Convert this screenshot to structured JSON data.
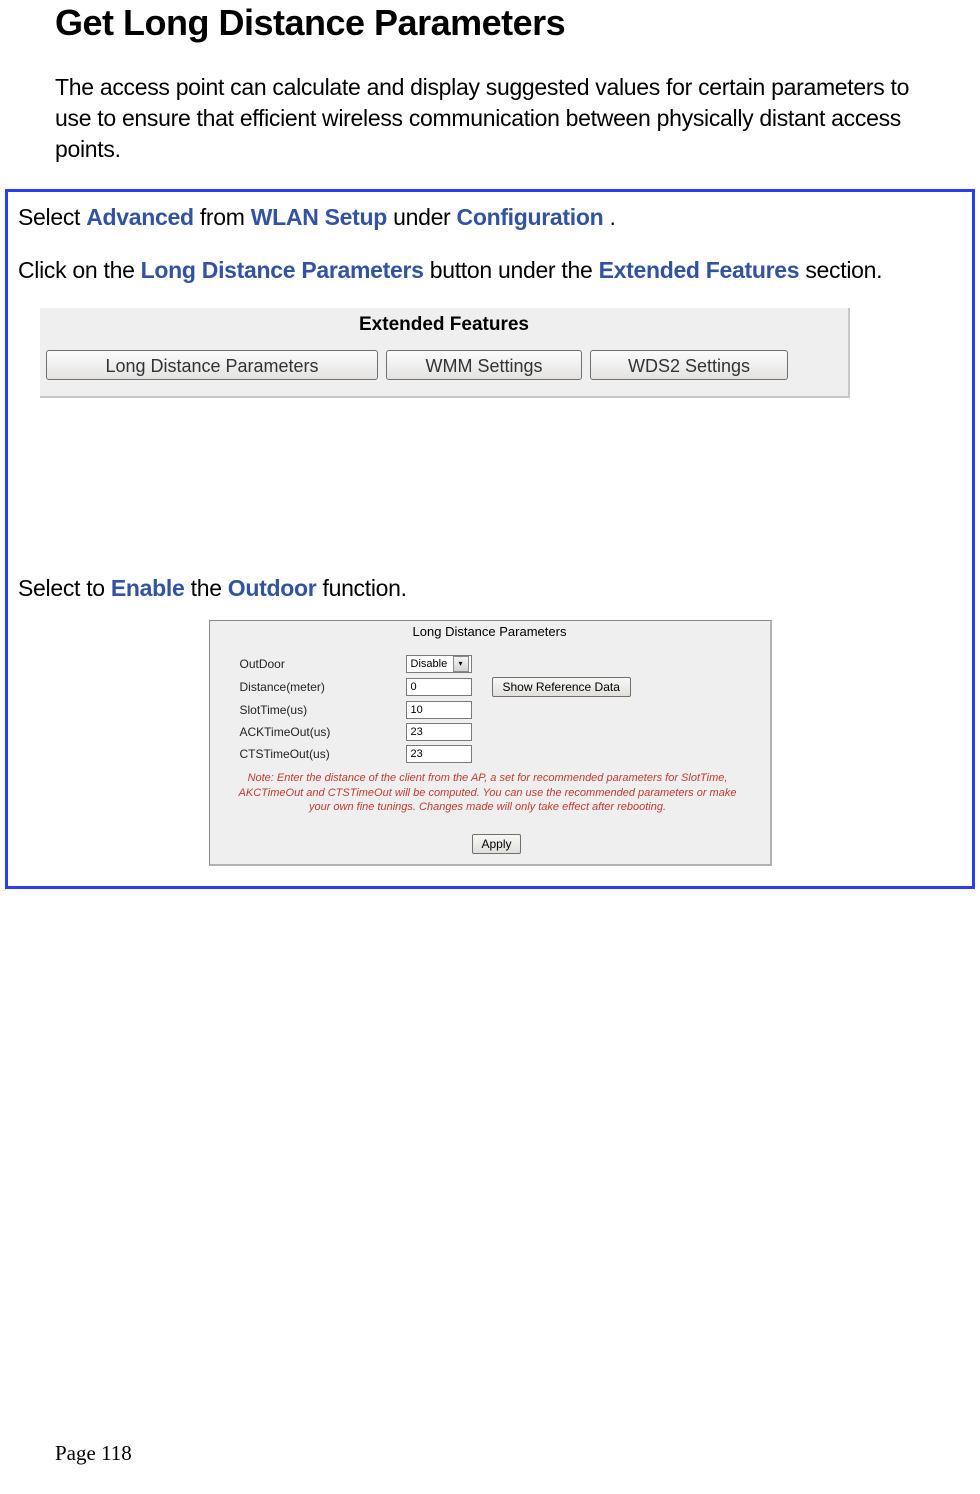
{
  "doc": {
    "title": "Get Long Distance Parameters",
    "intro": "The access point can calculate and display suggested values for certain parameters to use to ensure that efficient wireless communication between physically distant access points."
  },
  "steps": {
    "s1_pre": "Select ",
    "s1_t1": "Advanced",
    "s1_mid1": " from ",
    "s1_t2": "WLAN Setup",
    "s1_mid2": " under ",
    "s1_t3": "Configuration",
    "s1_post": ".",
    "s2_pre": "Click on the ",
    "s2_t1": "Long Distance Parameters",
    "s2_mid": " button under the ",
    "s2_t2": "Extended Features",
    "s2_post": " section.",
    "s3_pre": "Select to ",
    "s3_t1": "Enable",
    "s3_mid": " the ",
    "s3_t2": "Outdoor",
    "s3_post": " function."
  },
  "ef": {
    "title": "Extended Features",
    "btn_ldp": "Long Distance Parameters",
    "btn_wmm": "WMM Settings",
    "btn_wds2": "WDS2 Settings"
  },
  "ldp": {
    "title": "Long Distance Parameters",
    "labels": {
      "outdoor": "OutDoor",
      "distance": "Distance(meter)",
      "slot": "SlotTime(us)",
      "ack": "ACKTimeOut(us)",
      "cts": "CTSTimeOut(us)"
    },
    "values": {
      "outdoor": "Disable",
      "distance": "0",
      "slot": "10",
      "ack": "23",
      "cts": "23"
    },
    "ref_btn": "Show Reference Data",
    "note": "Note: Enter the distance of the client from the AP, a set for recommended parameters for SlotTime, AKCTimeOut and CTSTimeOut will be computed. You can use the recommended parameters or make your own fine tunings. Changes made will only take effect after rebooting.",
    "apply": "Apply"
  },
  "footer": {
    "page": "Page 118"
  }
}
